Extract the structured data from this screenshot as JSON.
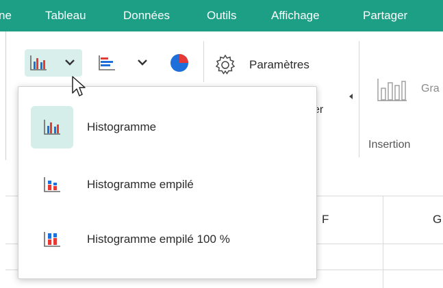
{
  "menubar": {
    "items": [
      {
        "label": "ne"
      },
      {
        "label": "Tableau"
      },
      {
        "label": "Données"
      },
      {
        "label": "Outils"
      },
      {
        "label": "Affichage"
      },
      {
        "label": "Partager"
      }
    ]
  },
  "toolbar": {
    "chart_button_icon": "column-chart-icon",
    "bar_button_icon": "bar-chart-icon",
    "pie_button_icon": "pie-chart-icon",
    "settings_icon": "gear-icon",
    "settings_label": "Paramètres",
    "truncated_label": "er",
    "gallery_label": "Gra",
    "insertion_group_label": "Insertion"
  },
  "sheet": {
    "col_f": "F",
    "col_g": "G"
  },
  "dropdown": {
    "items": [
      {
        "label": "Histogramme",
        "icon": "histogram-icon",
        "selected": true
      },
      {
        "label": "Histogramme empilé",
        "icon": "stacked-histogram-icon",
        "selected": false
      },
      {
        "label": "Histogramme empilé 100 %",
        "icon": "stacked-100-histogram-icon",
        "selected": false
      }
    ]
  },
  "colors": {
    "menubar_bg": "#1d9f86",
    "selected_bg": "#d5eee9",
    "chart_red": "#e53935",
    "chart_blue": "#1e6fd9"
  }
}
